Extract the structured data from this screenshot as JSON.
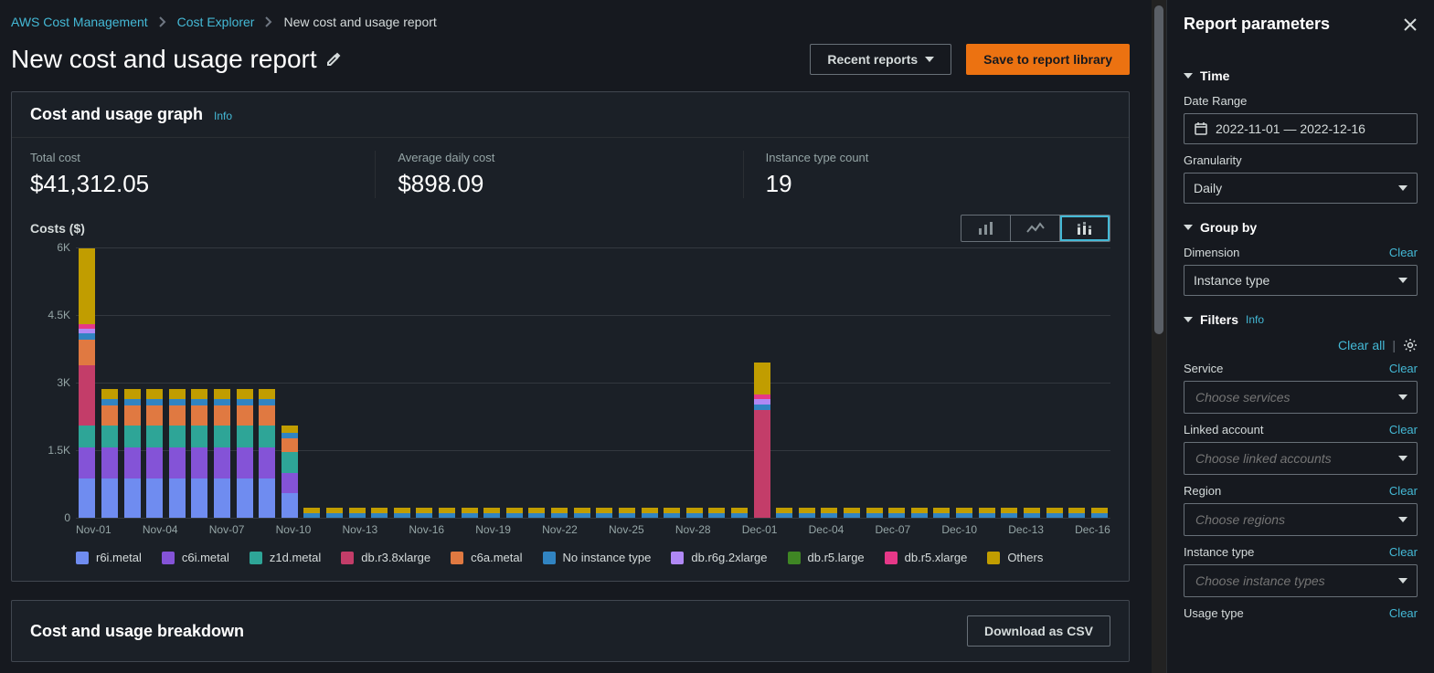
{
  "breadcrumbs": {
    "root": "AWS Cost Management",
    "mid": "Cost Explorer",
    "current": "New cost and usage report"
  },
  "title": "New cost and usage report",
  "buttons": {
    "recent_reports": "Recent reports",
    "save_library": "Save to report library",
    "download_csv": "Download as CSV"
  },
  "card": {
    "graph_title": "Cost and usage graph",
    "info": "Info",
    "kpis": {
      "total_cost_label": "Total cost",
      "total_cost_value": "$41,312.05",
      "avg_label": "Average daily cost",
      "avg_value": "$898.09",
      "count_label": "Instance type count",
      "count_value": "19"
    },
    "chart_title": "Costs ($)"
  },
  "breakdown": {
    "title": "Cost and usage breakdown"
  },
  "legend_series": [
    {
      "name": "r6i.metal",
      "color": "#6f8cf0"
    },
    {
      "name": "c6i.metal",
      "color": "#8453d7"
    },
    {
      "name": "z1d.metal",
      "color": "#2ea597"
    },
    {
      "name": "db.r3.8xlarge",
      "color": "#c33d69"
    },
    {
      "name": "c6a.metal",
      "color": "#e07941"
    },
    {
      "name": "No instance type",
      "color": "#3184c2"
    },
    {
      "name": "db.r6g.2xlarge",
      "color": "#b088f5"
    },
    {
      "name": "db.r5.large",
      "color": "#3f8624"
    },
    {
      "name": "db.r5.xlarge",
      "color": "#e63888"
    },
    {
      "name": "Others",
      "color": "#c19d00"
    }
  ],
  "right": {
    "title": "Report parameters",
    "time": {
      "section": "Time",
      "date_range_label": "Date Range",
      "date_range_value": "2022-11-01 — 2022-12-16",
      "granularity_label": "Granularity",
      "granularity_value": "Daily"
    },
    "groupby": {
      "section": "Group by",
      "dimension_label": "Dimension",
      "dimension_value": "Instance type",
      "clear": "Clear"
    },
    "filters": {
      "section": "Filters",
      "info": "Info",
      "clear_all": "Clear all",
      "items": [
        {
          "label": "Service",
          "placeholder": "Choose services"
        },
        {
          "label": "Linked account",
          "placeholder": "Choose linked accounts"
        },
        {
          "label": "Region",
          "placeholder": "Choose regions"
        },
        {
          "label": "Instance type",
          "placeholder": "Choose instance types"
        },
        {
          "label": "Usage type",
          "placeholder": ""
        }
      ],
      "clear": "Clear"
    }
  },
  "chart_data": {
    "type": "bar",
    "ylabel": "Costs ($)",
    "ylim": [
      0,
      6000
    ],
    "y_ticks": [
      0,
      1500,
      3000,
      4500,
      6000
    ],
    "y_tick_labels": [
      "0",
      "1.5K",
      "3K",
      "4.5K",
      "6K"
    ],
    "x_tick_labels": [
      "Nov-01",
      "",
      "",
      "Nov-04",
      "",
      "",
      "Nov-07",
      "",
      "",
      "Nov-10",
      "",
      "",
      "Nov-13",
      "",
      "",
      "Nov-16",
      "",
      "",
      "Nov-19",
      "",
      "",
      "Nov-22",
      "",
      "",
      "Nov-25",
      "",
      "",
      "Nov-28",
      "",
      "",
      "Dec-01",
      "",
      "",
      "Dec-04",
      "",
      "",
      "Dec-07",
      "",
      "",
      "Dec-10",
      "",
      "",
      "Dec-13",
      "",
      "",
      "Dec-16"
    ],
    "categories": [
      "Nov-01",
      "Nov-02",
      "Nov-03",
      "Nov-04",
      "Nov-05",
      "Nov-06",
      "Nov-07",
      "Nov-08",
      "Nov-09",
      "Nov-10",
      "Nov-11",
      "Nov-12",
      "Nov-13",
      "Nov-14",
      "Nov-15",
      "Nov-16",
      "Nov-17",
      "Nov-18",
      "Nov-19",
      "Nov-20",
      "Nov-21",
      "Nov-22",
      "Nov-23",
      "Nov-24",
      "Nov-25",
      "Nov-26",
      "Nov-27",
      "Nov-28",
      "Nov-29",
      "Nov-30",
      "Dec-01",
      "Dec-02",
      "Dec-03",
      "Dec-04",
      "Dec-05",
      "Dec-06",
      "Dec-07",
      "Dec-08",
      "Dec-09",
      "Dec-10",
      "Dec-11",
      "Dec-12",
      "Dec-13",
      "Dec-14",
      "Dec-15",
      "Dec-16"
    ],
    "series": [
      {
        "name": "r6i.metal",
        "color": "#6f8cf0",
        "values": [
          870,
          870,
          870,
          870,
          870,
          870,
          870,
          870,
          870,
          550,
          0,
          0,
          0,
          0,
          0,
          0,
          0,
          0,
          0,
          0,
          0,
          0,
          0,
          0,
          0,
          0,
          0,
          0,
          0,
          0,
          0,
          0,
          0,
          0,
          0,
          0,
          0,
          0,
          0,
          0,
          0,
          0,
          0,
          0,
          0,
          0
        ]
      },
      {
        "name": "c6i.metal",
        "color": "#8453d7",
        "values": [
          700,
          700,
          700,
          700,
          700,
          700,
          700,
          700,
          700,
          450,
          0,
          0,
          0,
          0,
          0,
          0,
          0,
          0,
          0,
          0,
          0,
          0,
          0,
          0,
          0,
          0,
          0,
          0,
          0,
          0,
          0,
          0,
          0,
          0,
          0,
          0,
          0,
          0,
          0,
          0,
          0,
          0,
          0,
          0,
          0,
          0
        ]
      },
      {
        "name": "z1d.metal",
        "color": "#2ea597",
        "values": [
          470,
          470,
          470,
          470,
          470,
          470,
          470,
          470,
          470,
          470,
          0,
          0,
          0,
          0,
          0,
          0,
          0,
          0,
          0,
          0,
          0,
          0,
          0,
          0,
          0,
          0,
          0,
          0,
          0,
          0,
          0,
          0,
          0,
          0,
          0,
          0,
          0,
          0,
          0,
          0,
          0,
          0,
          0,
          0,
          0,
          0
        ]
      },
      {
        "name": "db.r3.8xlarge",
        "color": "#c33d69",
        "values": [
          1350,
          0,
          0,
          0,
          0,
          0,
          0,
          0,
          0,
          0,
          0,
          0,
          0,
          0,
          0,
          0,
          0,
          0,
          0,
          0,
          0,
          0,
          0,
          0,
          0,
          0,
          0,
          0,
          0,
          0,
          2400,
          0,
          0,
          0,
          0,
          0,
          0,
          0,
          0,
          0,
          0,
          0,
          0,
          0,
          0,
          0
        ]
      },
      {
        "name": "c6a.metal",
        "color": "#e07941",
        "values": [
          570,
          460,
          460,
          460,
          460,
          460,
          460,
          460,
          460,
          300,
          0,
          0,
          0,
          0,
          0,
          0,
          0,
          0,
          0,
          0,
          0,
          0,
          0,
          0,
          0,
          0,
          0,
          0,
          0,
          0,
          0,
          0,
          0,
          0,
          0,
          0,
          0,
          0,
          0,
          0,
          0,
          0,
          0,
          0,
          0,
          0
        ]
      },
      {
        "name": "No instance type",
        "color": "#3184c2",
        "values": [
          140,
          140,
          140,
          140,
          140,
          140,
          140,
          140,
          140,
          110,
          110,
          110,
          110,
          110,
          110,
          110,
          110,
          110,
          110,
          110,
          110,
          110,
          110,
          110,
          110,
          110,
          110,
          110,
          110,
          110,
          110,
          110,
          110,
          110,
          110,
          110,
          110,
          110,
          110,
          110,
          110,
          110,
          110,
          110,
          110,
          110
        ]
      },
      {
        "name": "db.r6g.2xlarge",
        "color": "#b088f5",
        "values": [
          100,
          0,
          0,
          0,
          0,
          0,
          0,
          0,
          0,
          0,
          0,
          0,
          0,
          0,
          0,
          0,
          0,
          0,
          0,
          0,
          0,
          0,
          0,
          0,
          0,
          0,
          0,
          0,
          0,
          0,
          130,
          0,
          0,
          0,
          0,
          0,
          0,
          0,
          0,
          0,
          0,
          0,
          0,
          0,
          0,
          0
        ]
      },
      {
        "name": "db.r5.large",
        "color": "#3f8624",
        "values": [
          0,
          0,
          0,
          0,
          0,
          0,
          0,
          0,
          0,
          0,
          0,
          0,
          0,
          0,
          0,
          0,
          0,
          0,
          0,
          0,
          0,
          0,
          0,
          0,
          0,
          0,
          0,
          0,
          0,
          0,
          0,
          0,
          0,
          0,
          0,
          0,
          0,
          0,
          0,
          0,
          0,
          0,
          0,
          0,
          0,
          0
        ]
      },
      {
        "name": "db.r5.xlarge",
        "color": "#e63888",
        "values": [
          90,
          0,
          0,
          0,
          0,
          0,
          0,
          0,
          0,
          0,
          0,
          0,
          0,
          0,
          0,
          0,
          0,
          0,
          0,
          0,
          0,
          0,
          0,
          0,
          0,
          0,
          0,
          0,
          0,
          0,
          100,
          0,
          0,
          0,
          0,
          0,
          0,
          0,
          0,
          0,
          0,
          0,
          0,
          0,
          0,
          0
        ]
      },
      {
        "name": "Others",
        "color": "#c19d00",
        "values": [
          1700,
          210,
          210,
          210,
          210,
          210,
          210,
          210,
          210,
          160,
          110,
          110,
          110,
          110,
          110,
          110,
          110,
          110,
          110,
          110,
          110,
          110,
          110,
          110,
          110,
          110,
          110,
          110,
          110,
          110,
          700,
          110,
          110,
          110,
          110,
          110,
          110,
          110,
          110,
          110,
          110,
          110,
          110,
          110,
          110,
          110
        ]
      }
    ]
  }
}
